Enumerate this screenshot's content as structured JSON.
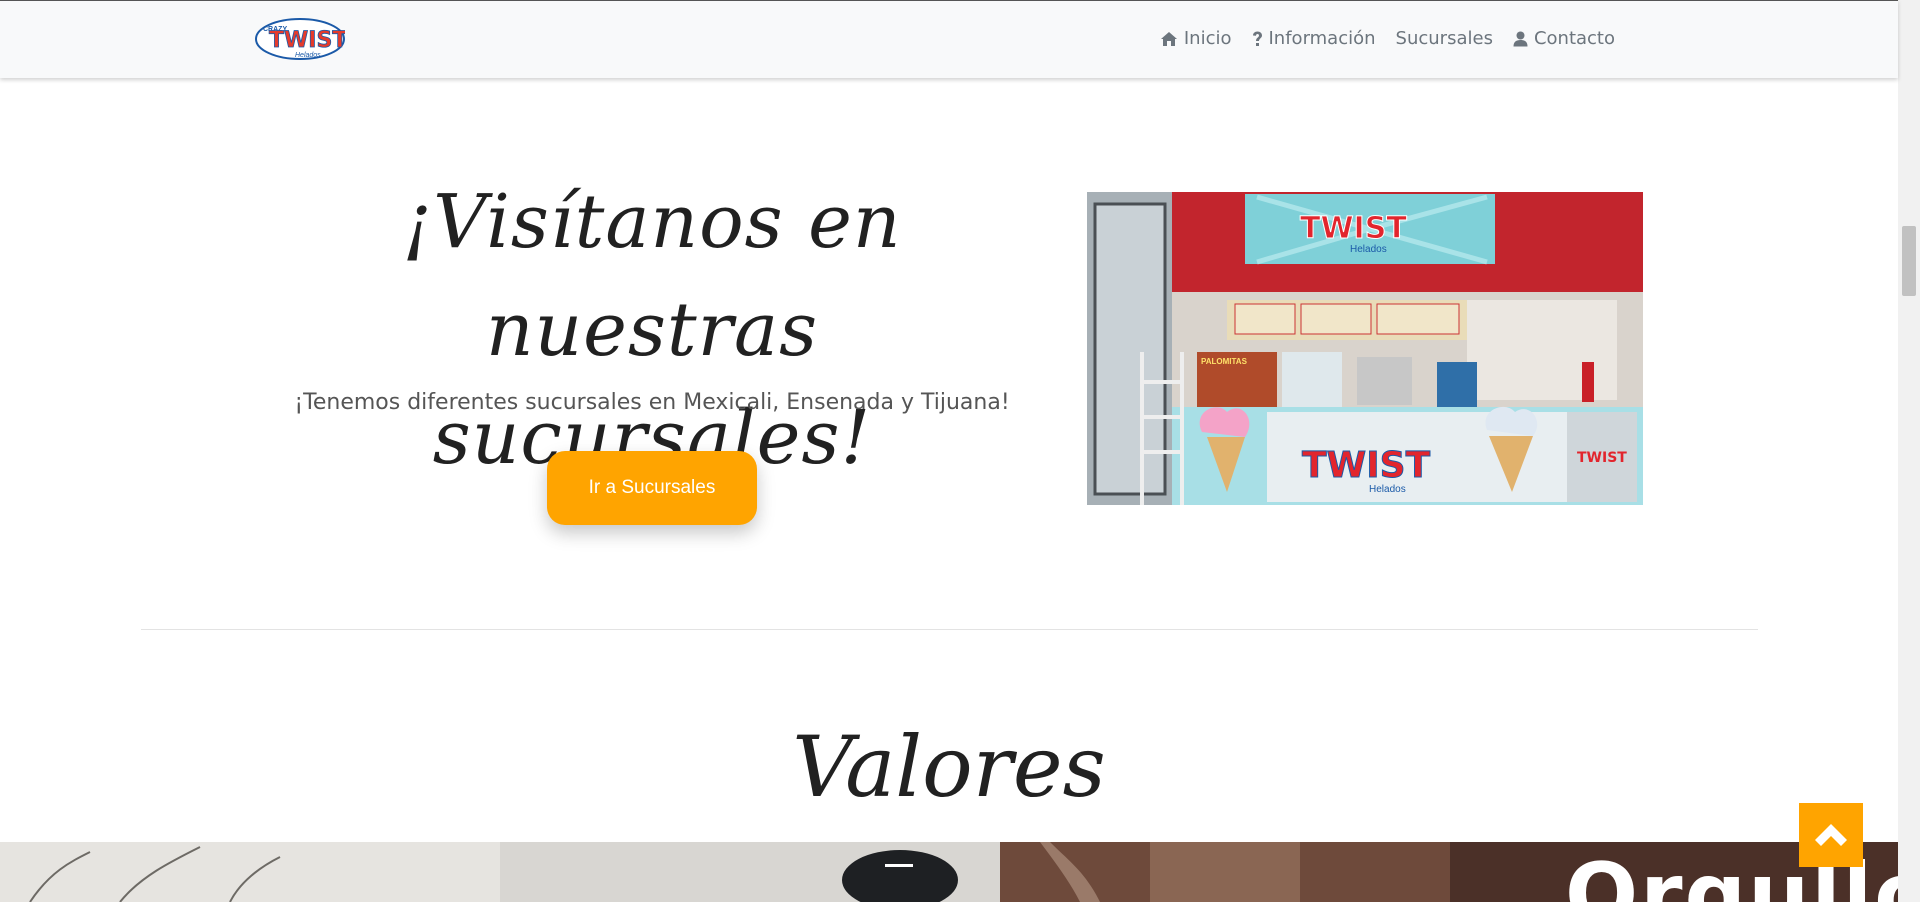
{
  "brand": {
    "logo_text": "TWIST",
    "logo_small_top": "CRAZY",
    "logo_small_bottom": "Helados"
  },
  "nav": {
    "items": [
      {
        "label": "Inicio",
        "icon": "home-icon"
      },
      {
        "label": "Información",
        "icon": "question-icon"
      },
      {
        "label": "Sucursales",
        "icon": ""
      },
      {
        "label": "Contacto",
        "icon": "user-icon"
      }
    ]
  },
  "hero": {
    "title": "¡Visítanos en nuestras sucursales!",
    "subtitle": "¡Tenemos diferentes sucursales en Mexicali, Ensenada y Tijuana!",
    "button_label": "Ir a Sucursales",
    "photo_sign": "TWIST",
    "photo_sign_sub": "Helados",
    "photo_menu_text": "PALOMITAS"
  },
  "values": {
    "heading": "Valores",
    "banner_word": "Orgullo"
  },
  "colors": {
    "accent": "#ffa400",
    "nav_bg": "#f8f9fa",
    "nav_text": "#6c757d",
    "heading": "#212121"
  },
  "icons": {
    "scroll_top": "chevron-up-icon"
  }
}
